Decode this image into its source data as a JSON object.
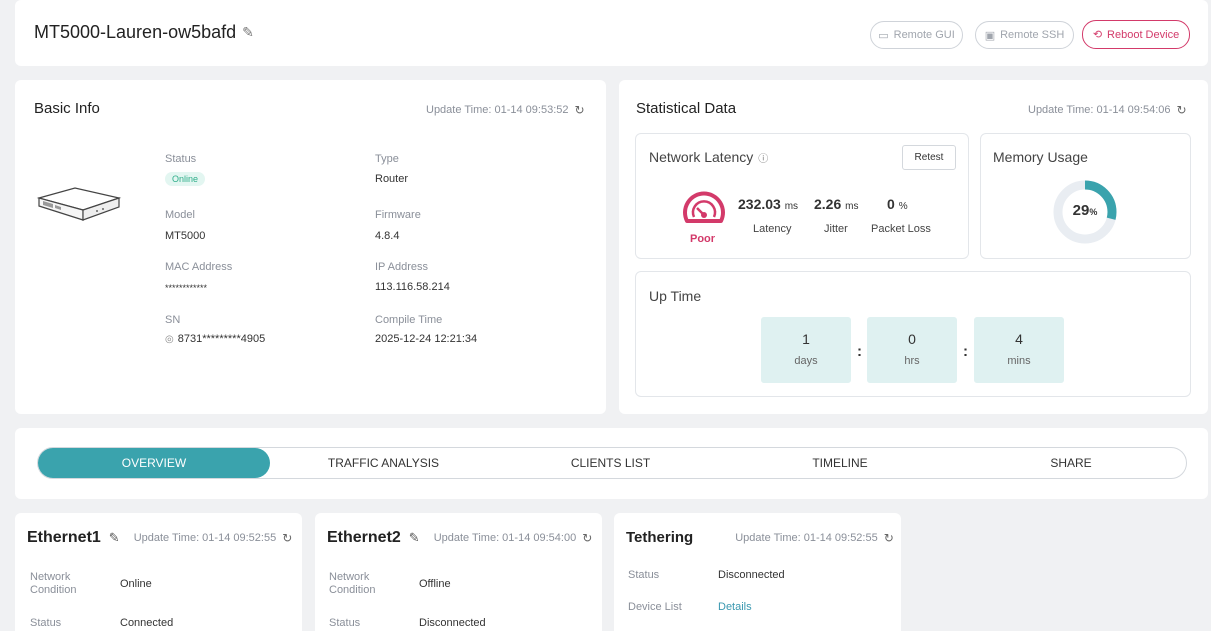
{
  "header": {
    "device_name": "MT5000-Lauren-ow5bafd",
    "buttons": {
      "remote_gui": "Remote GUI",
      "remote_ssh": "Remote SSH",
      "reboot": "Reboot Device"
    }
  },
  "basic_info": {
    "title": "Basic Info",
    "update_time": "Update Time: 01-14 09:53:52",
    "fields": {
      "status_label": "Status",
      "status_value": "Online",
      "type_label": "Type",
      "type_value": "Router",
      "model_label": "Model",
      "model_value": "MT5000",
      "firmware_label": "Firmware",
      "firmware_value": "4.8.4",
      "mac_label": "MAC Address",
      "mac_value": "************",
      "ip_label": "IP Address",
      "ip_value": "113.116.58.214",
      "sn_label": "SN",
      "sn_value": "8731*********4905",
      "compile_label": "Compile Time",
      "compile_value": "2025-12-24 12:21:34"
    }
  },
  "statistical": {
    "title": "Statistical Data",
    "update_time": "Update Time: 01-14 09:54:06",
    "latency": {
      "title": "Network Latency",
      "retest": "Retest",
      "rating": "Poor",
      "latency_value": "232.03",
      "latency_unit": "ms",
      "latency_label": "Latency",
      "jitter_value": "2.26",
      "jitter_unit": "ms",
      "jitter_label": "Jitter",
      "loss_value": "0",
      "loss_unit": "%",
      "loss_label": "Packet Loss"
    },
    "memory": {
      "title": "Memory Usage",
      "value": "29",
      "unit": "%",
      "fraction": 0.29
    },
    "uptime": {
      "title": "Up Time",
      "days": "1",
      "days_label": "days",
      "hrs": "0",
      "hrs_label": "hrs",
      "mins": "4",
      "mins_label": "mins"
    }
  },
  "tabs": [
    {
      "label": "OVERVIEW",
      "active": true
    },
    {
      "label": "TRAFFIC ANALYSIS"
    },
    {
      "label": "CLIENTS LIST"
    },
    {
      "label": "TIMELINE"
    },
    {
      "label": "SHARE"
    }
  ],
  "interfaces": [
    {
      "title": "Ethernet1",
      "update_time": "Update Time: 01-14 09:52:55",
      "rows": [
        {
          "label": "Network\nCondition",
          "value": "Online"
        },
        {
          "label": "Status",
          "value": "Connected"
        }
      ]
    },
    {
      "title": "Ethernet2",
      "update_time": "Update Time: 01-14 09:54:00",
      "rows": [
        {
          "label": "Network\nCondition",
          "value": "Offline"
        },
        {
          "label": "Status",
          "value": "Disconnected"
        }
      ]
    },
    {
      "title": "Tethering",
      "update_time": "Update Time: 01-14 09:52:55",
      "rows": [
        {
          "label": "Status",
          "value": "Disconnected"
        },
        {
          "label": "Device List",
          "value": "Details"
        }
      ]
    }
  ],
  "colors": {
    "accent": "#3aa3ad",
    "reboot": "#d33a6a",
    "poor": "#d33a6a",
    "online_badge_bg": "#e3f6f1",
    "online_badge_fg": "#2fae8a"
  }
}
